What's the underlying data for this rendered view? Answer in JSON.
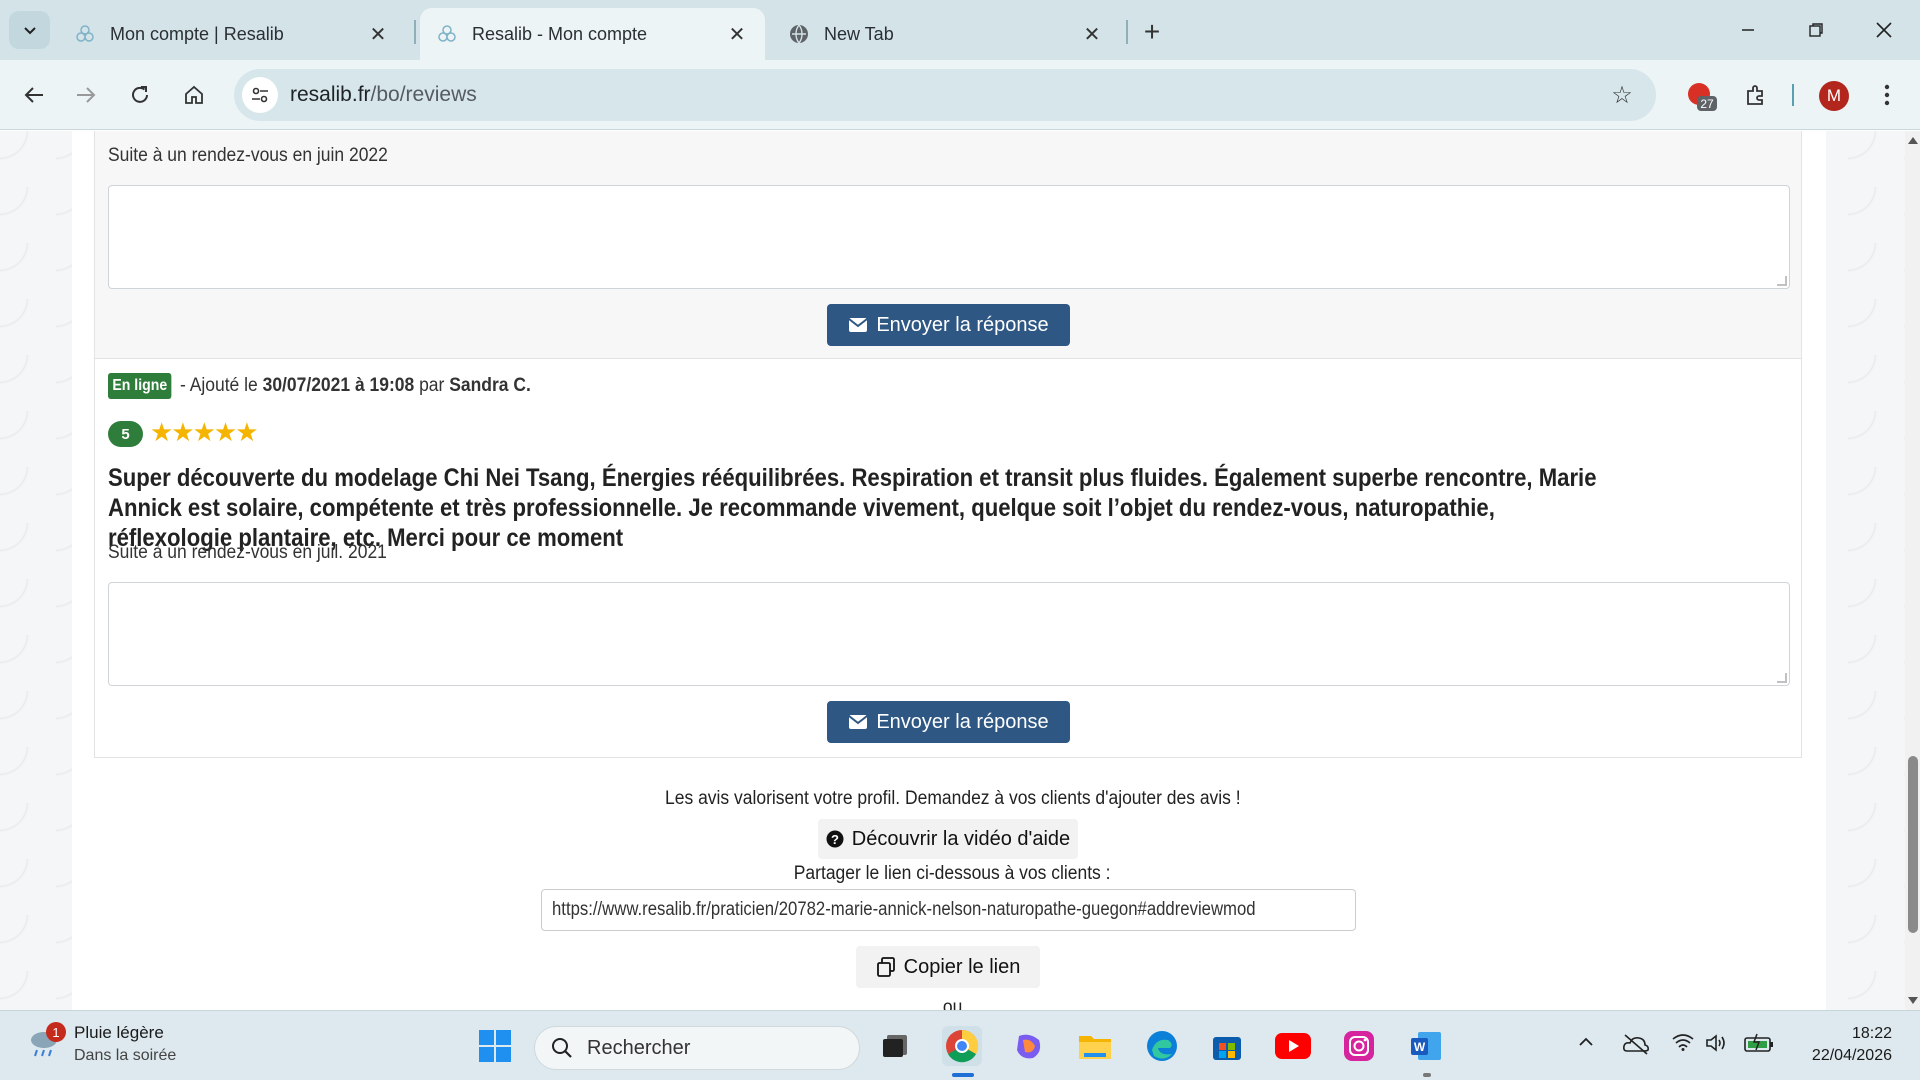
{
  "browser": {
    "tabs": [
      {
        "title": "Mon compte | Resalib",
        "active": false
      },
      {
        "title": "Resalib - Mon compte",
        "active": true
      },
      {
        "title": "New Tab",
        "active": false
      }
    ],
    "url_host": "resalib.fr",
    "url_path": "/bo/reviews",
    "extension_badge": "27",
    "profile_initial": "M"
  },
  "page": {
    "first_review": {
      "appointment_note": "Suite à un rendez-vous en juin 2022",
      "reply_button": "Envoyer la réponse"
    },
    "second_review": {
      "status_badge": "En ligne",
      "added_prefix": " - Ajouté le ",
      "date": "30/07/2021 à 19:08",
      "by": " par ",
      "author": "Sandra C.",
      "rating": "5",
      "stars": "★★★★★",
      "text": "Super découverte du modelage Chi Nei Tsang, Énergies rééquilibrées. Respiration et transit plus fluides. Également superbe rencontre, Marie Annick est solaire, compétente et très professionnelle. Je recommande vivement, quelque soit l’objet du rendez-vous, naturopathie, réflexologie plantaire, etc. Merci pour ce moment",
      "appointment_note": "Suite à un rendez-vous en juil. 2021",
      "reply_button": "Envoyer la réponse"
    },
    "footer": {
      "tip": "Les avis valorisent votre profil. Demandez à vos clients d'ajouter des avis !",
      "help_button": "Découvrir la vidéo d'aide",
      "share_label": "Partager le lien ci-dessous à vos clients :",
      "share_link": "https://www.resalib.fr/praticien/20782-marie-annick-nelson-naturopathe-guegon#addreviewmod",
      "copy_button": "Copier le lien",
      "or_text": "ou"
    }
  },
  "taskbar": {
    "weather_title": "Pluie légère",
    "weather_sub": "Dans la soirée",
    "weather_notif": "1",
    "search_placeholder": "Rechercher",
    "time": "18:22",
    "date": "22/04/2026"
  },
  "colors": {
    "primary_button": "#2e5784",
    "online_badge": "#2f7d3a",
    "star": "#f4b400",
    "tabstrip": "#d3e3e8"
  }
}
